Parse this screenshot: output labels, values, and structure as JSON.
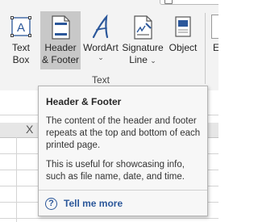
{
  "ribbon": {
    "buttons": [
      {
        "id": "text-box",
        "label_line1": "Text",
        "label_line2": "Box",
        "icon": "text-box-icon"
      },
      {
        "id": "header-footer",
        "label_line1": "Header",
        "label_line2": "& Footer",
        "icon": "header-footer-icon",
        "selected": true
      },
      {
        "id": "wordart",
        "label_line1": "WordArt",
        "label_line2": "",
        "icon": "wordart-icon",
        "has_dropdown": true
      },
      {
        "id": "signature-line",
        "label_line1": "Signature",
        "label_line2": "Line",
        "icon": "signature-line-icon",
        "has_dropdown": true
      },
      {
        "id": "object",
        "label_line1": "Object",
        "label_line2": "",
        "icon": "object-icon"
      }
    ],
    "group_label": "Text",
    "next_group_fragment": "E",
    "chevron": "⌄"
  },
  "sheet": {
    "cancel_glyph": "X"
  },
  "tooltip": {
    "title": "Header & Footer",
    "paragraph1": "The content of the header and footer repeats at the top and bottom of each printed page.",
    "paragraph2": "This is useful for showcasing info, such as file name, date, and time.",
    "help_glyph": "?",
    "tell_me_more": "Tell me more"
  },
  "colors": {
    "accent_blue": "#2b579a",
    "selected_button_bg": "#c8c8c8",
    "ribbon_bg": "#f3f3f3"
  }
}
